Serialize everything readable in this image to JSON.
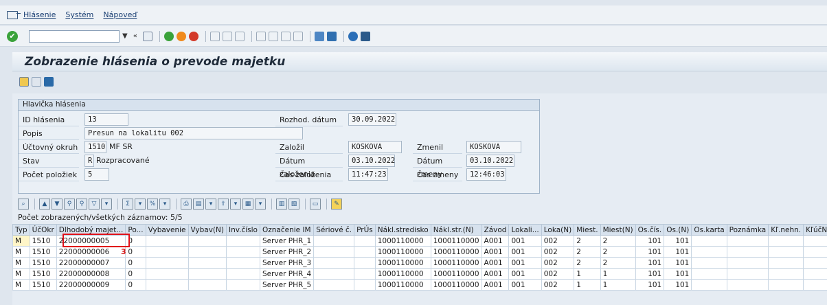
{
  "menu": [
    "Hlásenie",
    "Systém",
    "Nápoveď"
  ],
  "title": "Zobrazenie hlásenia o prevode majetku",
  "header_panel": {
    "title": "Hlavička hlásenia",
    "id_label": "ID hlásenia",
    "id_value": "13",
    "popis_label": "Popis",
    "popis_value": "Presun na lokalitu 002",
    "okruh_label": "Účtovný okruh",
    "okruh_code": "1510",
    "okruh_text": "MF SR",
    "stav_label": "Stav",
    "stav_code": "R",
    "stav_text": "Rozpracované",
    "pocet_label": "Počet položiek",
    "pocet_value": "5",
    "rozhod_label": "Rozhod. dátum",
    "rozhod_value": "30.09.2022",
    "zalozil_label": "Založil",
    "zalozil_value": "KOSKOVA",
    "zmenil_label": "Zmenil",
    "zmenil_value": "KOSKOVA",
    "datum_zal_label": "Dátum založenia",
    "datum_zal_value": "03.10.2022",
    "datum_zm_label": "Dátum zmeny",
    "datum_zm_value": "03.10.2022",
    "cas_zal_label": "Čas založenia",
    "cas_zal_value": "11:47:23",
    "cas_zm_label": "Čas zmeny",
    "cas_zm_value": "12:46:03"
  },
  "count_text": "Počet zobrazených/všetkých záznamov: 5/5",
  "table": {
    "columns": [
      "Typ",
      "ÚčOkr",
      "Dlhodobý majet...",
      "Po...",
      "Vybavenie",
      "Vybav(N)",
      "Inv.číslo",
      "Označenie IM",
      "Sériové č.",
      "PrÚs",
      "Nákl.stredisko",
      "Nákl.str.(N)",
      "Závod",
      "Lokali...",
      "Loka(N)",
      "Miest.",
      "Miest(N)",
      "Os.čís.",
      "Os.(N)",
      "Os.karta",
      "Poznámka",
      "Kľ.nehn.",
      "KľúčNe(N)"
    ],
    "rows": [
      [
        "M",
        "1510",
        "22000000005",
        "0",
        "",
        "",
        "",
        "Server PHR_1",
        "",
        "",
        "1000110000",
        "1000110000",
        "A001",
        "001",
        "002",
        "2",
        "2",
        "101",
        "101",
        "",
        "",
        "",
        ""
      ],
      [
        "M",
        "1510",
        "22000000006",
        "0",
        "",
        "",
        "",
        "Server PHR_2",
        "",
        "",
        "1000110000",
        "1000110000",
        "A001",
        "001",
        "002",
        "2",
        "2",
        "101",
        "101",
        "",
        "",
        "",
        ""
      ],
      [
        "M",
        "1510",
        "22000000007",
        "0",
        "",
        "",
        "",
        "Server PHR_3",
        "",
        "",
        "1000110000",
        "1000110000",
        "A001",
        "001",
        "002",
        "2",
        "2",
        "101",
        "101",
        "",
        "",
        "",
        ""
      ],
      [
        "M",
        "1510",
        "22000000008",
        "0",
        "",
        "",
        "",
        "Server PHR_4",
        "",
        "",
        "1000110000",
        "1000110000",
        "A001",
        "001",
        "002",
        "1",
        "1",
        "101",
        "101",
        "",
        "",
        "",
        ""
      ],
      [
        "M",
        "1510",
        "22000000009",
        "0",
        "",
        "",
        "",
        "Server PHR_5",
        "",
        "",
        "1000110000",
        "1000110000",
        "A001",
        "001",
        "002",
        "1",
        "1",
        "101",
        "101",
        "",
        "",
        "",
        ""
      ]
    ]
  },
  "annotation": "3",
  "colors": {
    "highlight": "#e0111a",
    "selected_cell": "#fff6c8"
  }
}
